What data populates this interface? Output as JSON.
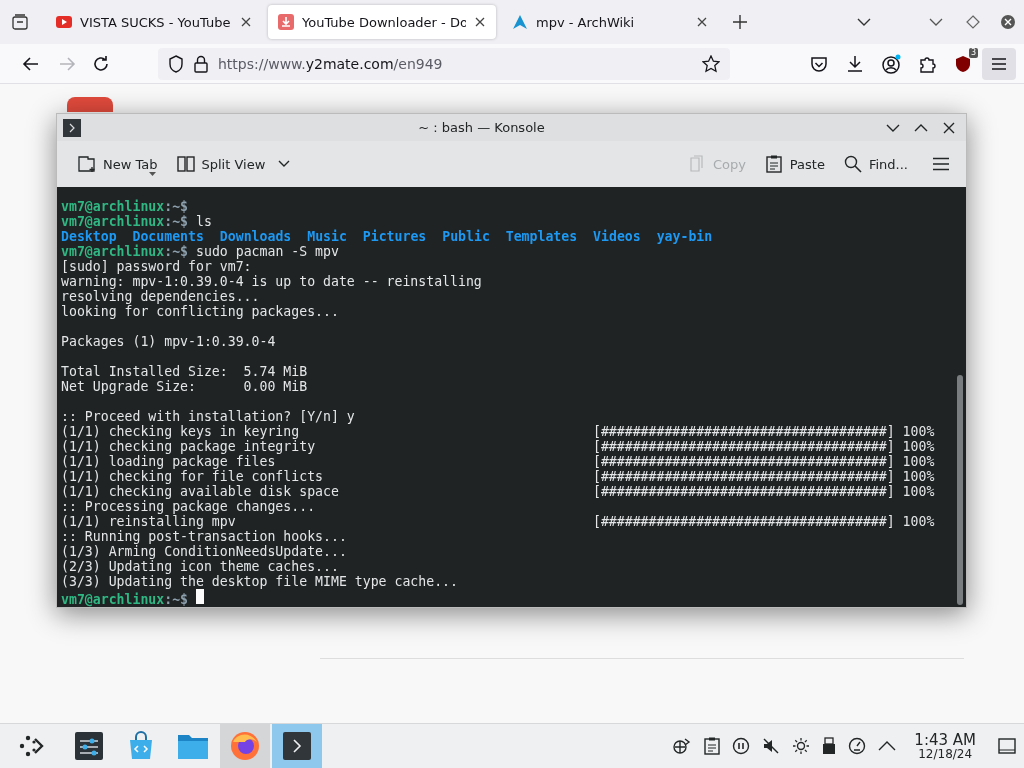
{
  "browser": {
    "tabs": [
      {
        "kind": "video",
        "title": "VISTA SUCKS - YouTube",
        "selected": false
      },
      {
        "kind": "download",
        "title": "YouTube Downloader - Do",
        "selected": true
      },
      {
        "kind": "wiki",
        "title": "mpv - ArchWiki",
        "selected": false
      }
    ],
    "url": {
      "prefix": "https://www.",
      "domain": "y2mate.com",
      "path": "/en949"
    },
    "forward_disabled": true,
    "extension_badge": "3"
  },
  "konsole": {
    "title": "~ : bash — Konsole",
    "toolbar_left": [
      {
        "kind": "new-tab",
        "label": "New Tab",
        "disabled": false
      },
      {
        "kind": "split",
        "label": "Split View",
        "disabled": false
      }
    ],
    "toolbar_right": [
      {
        "kind": "copy",
        "label": "Copy",
        "disabled": true
      },
      {
        "kind": "paste",
        "label": "Paste",
        "disabled": false
      },
      {
        "kind": "find",
        "label": "Find...",
        "disabled": false
      }
    ],
    "cursor": true,
    "lines": [
      {
        "kind": "prompt",
        "host": "vm7@archlinux",
        "path": ":~$"
      },
      {
        "kind": "prompt",
        "host": "vm7@archlinux",
        "path": ":~$",
        "command": "ls"
      },
      {
        "kind": "listing",
        "items": [
          "Desktop",
          "Documents",
          "Downloads",
          "Music",
          "Pictures",
          "Public",
          "Templates",
          "Videos",
          "yay-bin"
        ]
      },
      {
        "kind": "prompt",
        "host": "vm7@archlinux",
        "path": ":~$",
        "command": "sudo pacman -S mpv"
      },
      {
        "kind": "output",
        "text": "[sudo] password for vm7:"
      },
      {
        "kind": "output",
        "text": "warning: mpv-1:0.39.0-4 is up to date -- reinstalling"
      },
      {
        "kind": "output",
        "text": "resolving dependencies..."
      },
      {
        "kind": "output",
        "text": "looking for conflicting packages..."
      },
      {
        "kind": "blank"
      },
      {
        "kind": "output",
        "text": "Packages (1) mpv-1:0.39.0-4"
      },
      {
        "kind": "blank"
      },
      {
        "kind": "output",
        "text": "Total Installed Size:  5.74 MiB"
      },
      {
        "kind": "output",
        "text": "Net Upgrade Size:      0.00 MiB"
      },
      {
        "kind": "blank"
      },
      {
        "kind": "output",
        "text": ":: Proceed with installation? [Y/n] y"
      },
      {
        "kind": "progress",
        "text": "(1/1) checking keys in keyring",
        "bar": "[####################################]",
        "percent": "100%"
      },
      {
        "kind": "progress",
        "text": "(1/1) checking package integrity",
        "bar": "[####################################]",
        "percent": "100%"
      },
      {
        "kind": "progress",
        "text": "(1/1) loading package files",
        "bar": "[####################################]",
        "percent": "100%"
      },
      {
        "kind": "progress",
        "text": "(1/1) checking for file conflicts",
        "bar": "[####################################]",
        "percent": "100%"
      },
      {
        "kind": "progress",
        "text": "(1/1) checking available disk space",
        "bar": "[####################################]",
        "percent": "100%"
      },
      {
        "kind": "output",
        "text": ":: Processing package changes..."
      },
      {
        "kind": "progress",
        "text": "(1/1) reinstalling mpv",
        "bar": "[####################################]",
        "percent": "100%"
      },
      {
        "kind": "output",
        "text": ":: Running post-transaction hooks..."
      },
      {
        "kind": "output",
        "text": "(1/3) Arming ConditionNeedsUpdate..."
      },
      {
        "kind": "output",
        "text": "(2/3) Updating icon theme caches..."
      },
      {
        "kind": "output",
        "text": "(3/3) Updating the desktop file MIME type cache..."
      },
      {
        "kind": "prompt",
        "host": "vm7@archlinux",
        "path": ":~$"
      }
    ]
  },
  "taskbar": {
    "apps": [
      {
        "kind": "settings",
        "open": false,
        "selected": false
      },
      {
        "kind": "store",
        "open": false,
        "selected": false
      },
      {
        "kind": "files",
        "open": false,
        "selected": false
      },
      {
        "kind": "browser",
        "open": true,
        "selected": false
      },
      {
        "kind": "terminal",
        "open": true,
        "selected": true
      }
    ],
    "clock": {
      "time": "1:43 AM",
      "date": "12/18/24"
    }
  }
}
